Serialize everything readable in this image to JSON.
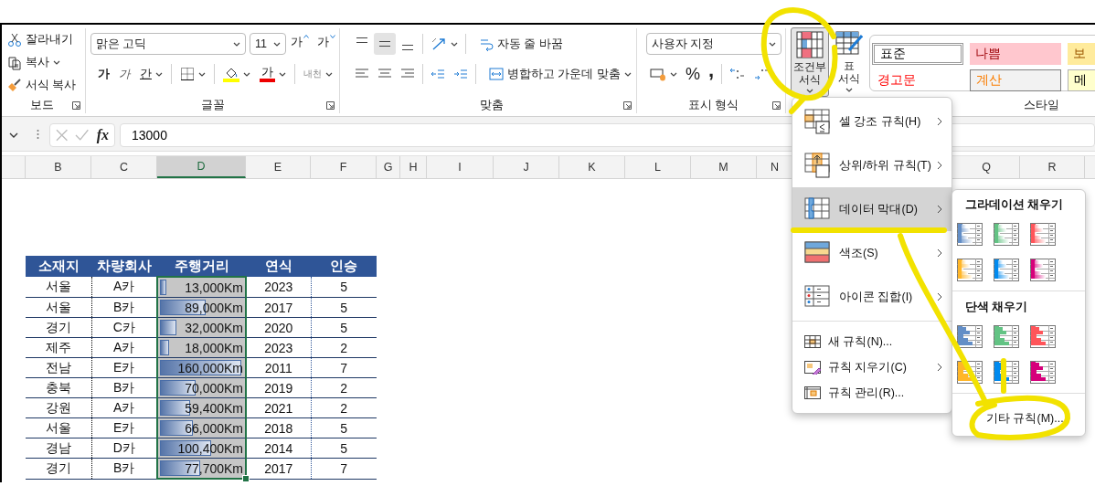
{
  "ribbon": {
    "clipboard": {
      "label": "보드",
      "items": [
        {
          "label": "잘라내기",
          "kind": "cut",
          "dropdown": false
        },
        {
          "label": "복사",
          "kind": "copy",
          "dropdown": true
        },
        {
          "label": "서식 복사",
          "kind": "painter",
          "dropdown": false
        }
      ]
    },
    "font": {
      "label": "글꼴",
      "font_name": "맑은 고딕",
      "font_size": "11",
      "grow": "가",
      "shrink": "가",
      "bold": "가",
      "italic": "가",
      "underline": "간",
      "font_color": "가",
      "phonetic": "내천"
    },
    "alignment": {
      "label": "맞춤",
      "vertical": [
        {
          "kind": "top",
          "selected": false
        },
        {
          "kind": "middle",
          "selected": true
        },
        {
          "kind": "bottom",
          "selected": false
        }
      ],
      "wrap_text": "자동 줄 바꿈",
      "merge_center": "병합하고 가운데 맞춤"
    },
    "number": {
      "label": "표시 형식",
      "format": "사용자 지정",
      "percent": "%",
      "comma": ","
    },
    "styles": {
      "label": "스타일",
      "conditional_formatting": {
        "label": "조건부 서식",
        "pressed": true
      },
      "format_as_table": "표 서식",
      "cell_styles": [
        {
          "label": "표준",
          "kind": "normal"
        },
        {
          "label": "나쁨",
          "kind": "bad"
        },
        {
          "label": "보",
          "kind": "neutral"
        },
        {
          "label": "경고문",
          "kind": "warning"
        },
        {
          "label": "계산",
          "kind": "calculation"
        },
        {
          "label": "메",
          "kind": "note"
        }
      ]
    }
  },
  "formula_bar": {
    "fx": "fx",
    "value": "13000"
  },
  "column_headers": [
    {
      "label": "B",
      "selected": false
    },
    {
      "label": "C",
      "selected": false
    },
    {
      "label": "D",
      "selected": true
    },
    {
      "label": "E",
      "selected": false
    },
    {
      "label": "F",
      "selected": false
    },
    {
      "label": "G",
      "selected": false
    },
    {
      "label": "H",
      "selected": false
    },
    {
      "label": "I",
      "selected": false
    },
    {
      "label": "J",
      "selected": false
    },
    {
      "label": "K",
      "selected": false
    },
    {
      "label": "L",
      "selected": false
    },
    {
      "label": "M",
      "selected": false
    },
    {
      "label": "N",
      "selected": false
    },
    {
      "label": "Q",
      "selected": false
    },
    {
      "label": "R",
      "selected": false
    }
  ],
  "table": {
    "columns": [
      "소재지",
      "차량회사",
      "주행거리",
      "연식",
      "인승"
    ],
    "rows": [
      {
        "region": "서울",
        "company": "A카",
        "distance": "13,000Km",
        "level": 0.08,
        "year": "2023",
        "seats": "5"
      },
      {
        "region": "서울",
        "company": "B카",
        "distance": "89,000Km",
        "level": 0.56,
        "year": "2017",
        "seats": "5"
      },
      {
        "region": "경기",
        "company": "C카",
        "distance": "32,000Km",
        "level": 0.2,
        "year": "2020",
        "seats": "5"
      },
      {
        "region": "제주",
        "company": "A카",
        "distance": "18,000Km",
        "level": 0.11,
        "year": "2023",
        "seats": "2"
      },
      {
        "region": "전남",
        "company": "E카",
        "distance": "160,000Km",
        "level": 1,
        "year": "2011",
        "seats": "7"
      },
      {
        "region": "충북",
        "company": "B카",
        "distance": "70,000Km",
        "level": 0.44,
        "year": "2019",
        "seats": "2"
      },
      {
        "region": "강원",
        "company": "A카",
        "distance": "59,400Km",
        "level": 0.37,
        "year": "2021",
        "seats": "2"
      },
      {
        "region": "서울",
        "company": "E카",
        "distance": "66,000Km",
        "level": 0.41,
        "year": "2018",
        "seats": "5"
      },
      {
        "region": "경남",
        "company": "D카",
        "distance": "100,400Km",
        "level": 0.63,
        "year": "2014",
        "seats": "5"
      },
      {
        "region": "경기",
        "company": "B카",
        "distance": "77,700Km",
        "level": 0.49,
        "year": "2017",
        "seats": "7"
      }
    ]
  },
  "conditional_menu": {
    "items": [
      {
        "label": "셀 강조 규칙(H)",
        "kind": "highlight",
        "submenu": true,
        "selected": false
      },
      {
        "label": "상위/하위 규칙(T)",
        "kind": "topbottom",
        "submenu": true,
        "selected": false
      },
      {
        "label": "데이터 막대(D)",
        "kind": "databar",
        "submenu": true,
        "selected": true
      },
      {
        "label": "색조(S)",
        "kind": "colorscale",
        "submenu": true,
        "selected": false
      },
      {
        "label": "아이콘 집합(I)",
        "kind": "iconset",
        "submenu": true,
        "selected": false
      },
      {
        "label": "새 규칙(N)...",
        "kind": "new",
        "submenu": false,
        "selected": false
      },
      {
        "label": "규칙 지우기(C)",
        "kind": "clear",
        "submenu": true,
        "selected": false
      },
      {
        "label": "규칙 관리(R)...",
        "kind": "manage",
        "submenu": false,
        "selected": false
      }
    ],
    "submenu": {
      "gradient_heading": "그라데이션 채우기",
      "gradient_fills": [
        {
          "color": "#638ec6"
        },
        {
          "color": "#63c384"
        },
        {
          "color": "#ff555a"
        },
        {
          "color": "#ffb628"
        },
        {
          "color": "#008aef"
        },
        {
          "color": "#d6007b"
        }
      ],
      "solid_heading": "단색 채우기",
      "solid_fills": [
        {
          "color": "#638ec6"
        },
        {
          "color": "#63c384"
        },
        {
          "color": "#ff555a"
        },
        {
          "color": "#ffb628"
        },
        {
          "color": "#008aef"
        },
        {
          "color": "#d6007b"
        }
      ],
      "more_rules": "기타 규칙(M)..."
    }
  }
}
